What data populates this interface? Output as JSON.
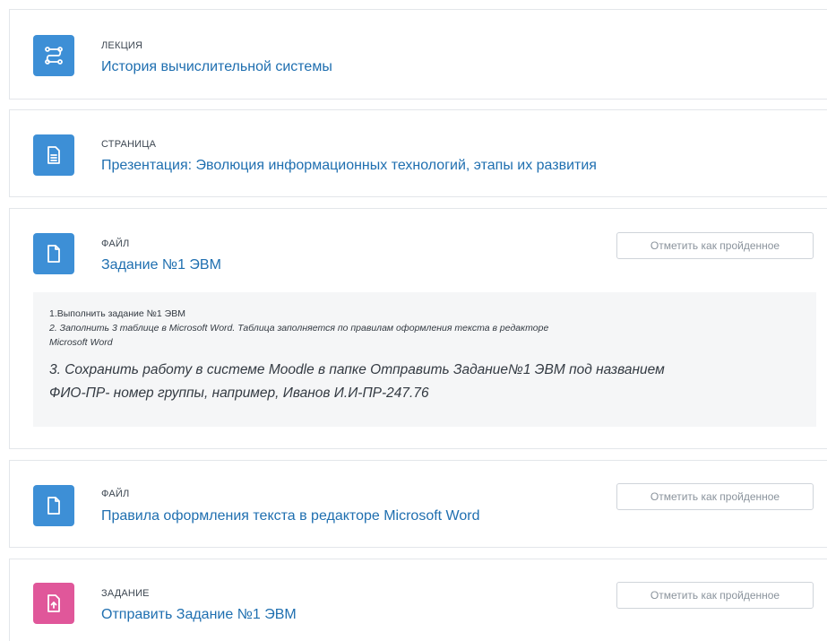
{
  "colors": {
    "icon_blue": "#3d8fd6",
    "icon_pink": "#e0579a",
    "link_blue": "#1f6fb0",
    "button_text": "#8a939c"
  },
  "activities": [
    {
      "type_label": "ЛЕКЦИЯ",
      "title": "История вычислительной системы",
      "icon": "lesson-icon"
    },
    {
      "type_label": "СТРАНИЦА",
      "title": "Презентация: Эволюция информационных технологий, этапы их развития",
      "icon": "page-icon"
    },
    {
      "type_label": "ФАЙЛ",
      "title": "Задание №1 ЭВМ",
      "icon": "file-icon",
      "completion_button": "Отметить как пройденное",
      "description": {
        "line1": "1.Выполнить  задание №1 ЭВМ",
        "line2": "2. Заполнить 3 таблице в Microsoft Word. Таблица заполняется по правилам оформления текста в редакторе",
        "line3": "Microsoft Word",
        "line4": "3. Сохранить работу в системе Moodle в папке Отправить Задание№1 ЭВМ под названием",
        "line5": "ФИО-ПР- номер группы, например, Иванов И.И-ПР-247.76"
      }
    },
    {
      "type_label": "ФАЙЛ",
      "title": "Правила оформления текста в редакторе Microsoft Word",
      "icon": "file-icon",
      "completion_button": "Отметить как пройденное"
    },
    {
      "type_label": "ЗАДАНИЕ",
      "title": "Отправить Задание №1 ЭВМ",
      "icon": "assignment-icon",
      "completion_button": "Отметить как пройденное"
    }
  ]
}
